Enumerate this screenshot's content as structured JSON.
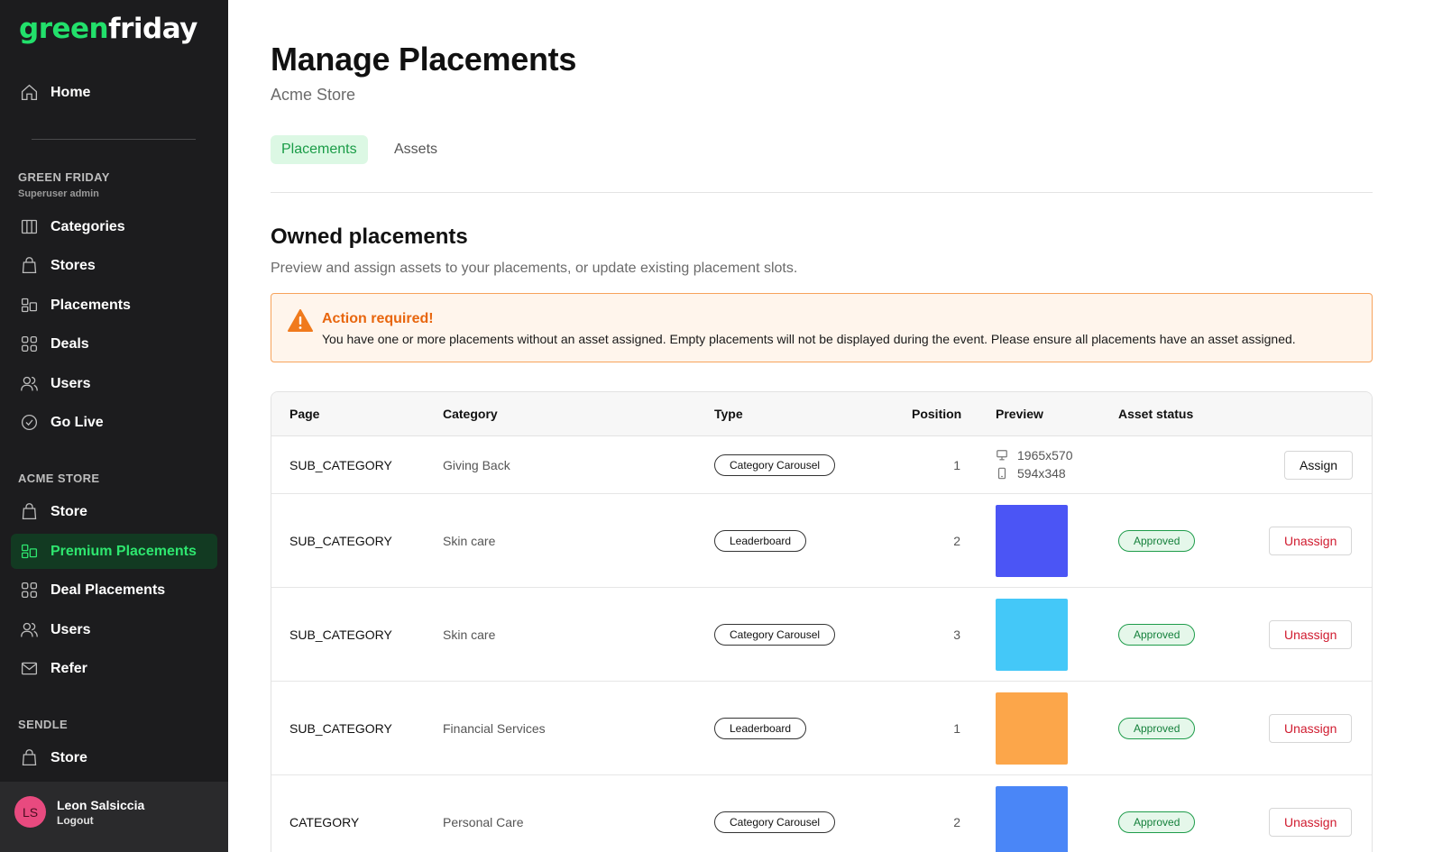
{
  "brand": {
    "part1": "green",
    "part2": "friday"
  },
  "sidebar": {
    "home": "Home",
    "section1": {
      "title": "GREEN FRIDAY",
      "subtitle": "Superuser admin"
    },
    "items1": [
      "Categories",
      "Stores",
      "Placements",
      "Deals",
      "Users",
      "Go Live"
    ],
    "section2": {
      "title": "ACME STORE"
    },
    "items2": [
      "Store",
      "Premium Placements",
      "Deal Placements",
      "Users",
      "Refer"
    ],
    "section3": {
      "title": "SENDLE"
    },
    "items3": [
      "Store"
    ],
    "user": {
      "initials": "LS",
      "name": "Leon Salsiccia",
      "action": "Logout"
    }
  },
  "page": {
    "title": "Manage Placements",
    "subtitle": "Acme Store",
    "tabs": [
      "Placements",
      "Assets"
    ],
    "active_tab": "Placements"
  },
  "section": {
    "title": "Owned placements",
    "description": "Preview and assign assets to your placements, or update existing placement slots."
  },
  "alert": {
    "title": "Action required!",
    "text": "You have one or more placements without an asset assigned. Empty placements will not be displayed during the event. Please ensure all placements have an asset assigned."
  },
  "table": {
    "headers": [
      "Page",
      "Category",
      "Type",
      "Position",
      "Preview",
      "Asset status"
    ],
    "rows": [
      {
        "page": "SUB_CATEGORY",
        "category": "Giving Back",
        "type": "Category Carousel",
        "position": "1",
        "preview_desktop": "1965x570",
        "preview_mobile": "594x348",
        "status": "",
        "action": "Assign"
      },
      {
        "page": "SUB_CATEGORY",
        "category": "Skin care",
        "type": "Leaderboard",
        "position": "2",
        "color": "#4b55f5",
        "status": "Approved",
        "action": "Unassign"
      },
      {
        "page": "SUB_CATEGORY",
        "category": "Skin care",
        "type": "Category Carousel",
        "position": "3",
        "color": "#44c8f8",
        "status": "Approved",
        "action": "Unassign"
      },
      {
        "page": "SUB_CATEGORY",
        "category": "Financial Services",
        "type": "Leaderboard",
        "position": "1",
        "color": "#fca64a",
        "status": "Approved",
        "action": "Unassign"
      },
      {
        "page": "CATEGORY",
        "category": "Personal Care",
        "type": "Category Carousel",
        "position": "2",
        "color": "#4a86f7",
        "status": "Approved",
        "action": "Unassign"
      }
    ]
  },
  "colors": {
    "sidebar_bg": "#1c1c1e",
    "brand_green": "#22e06b",
    "alert_orange": "#e8660e",
    "danger_red": "#d01b2f",
    "approved_green": "#14803b"
  }
}
